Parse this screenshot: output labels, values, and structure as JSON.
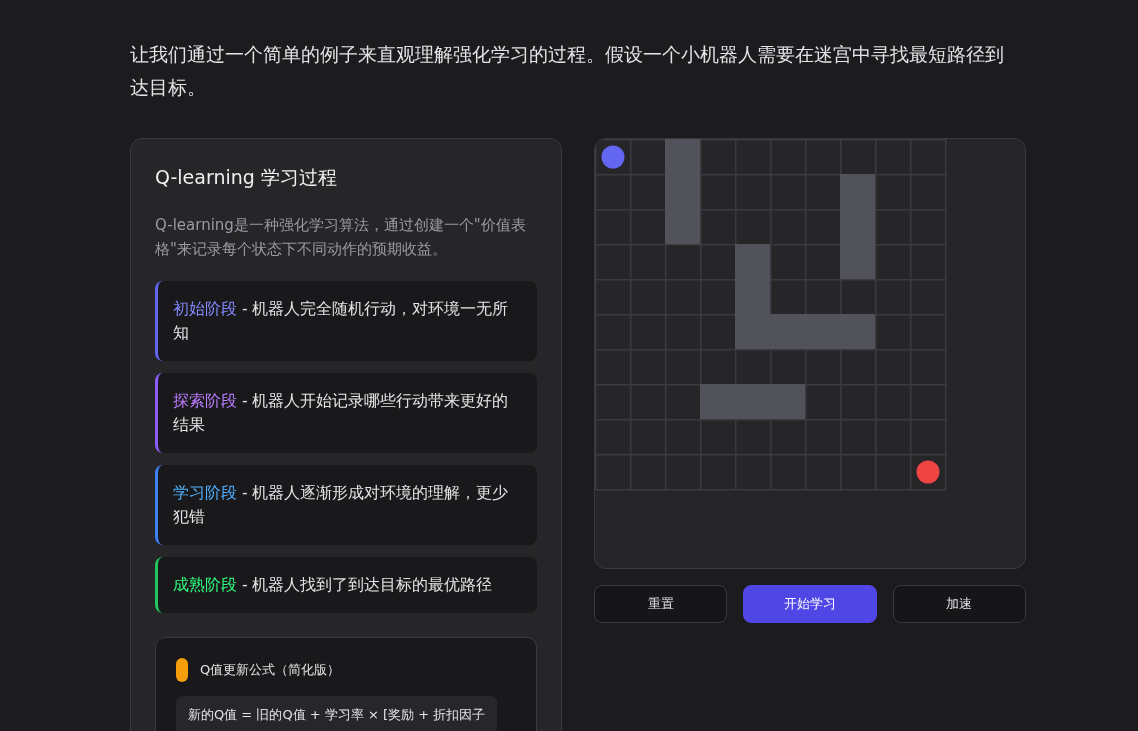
{
  "intro": "让我们通过一个简单的例子来直观理解强化学习的过程。假设一个小机器人需要在迷宫中寻找最短路径到达目标。",
  "card": {
    "title": "Q-learning 学习过程",
    "description": "Q-learning是一种强化学习算法，通过创建一个\"价值表格\"来记录每个状态下不同动作的预期收益。",
    "phases": [
      {
        "label": "初始阶段",
        "text": " - 机器人完全随机行动，对环境一无所知",
        "color": "#6366f1"
      },
      {
        "label": "探索阶段",
        "text": " - 机器人开始记录哪些行动带来更好的结果",
        "color": "#8b5cf6"
      },
      {
        "label": "学习阶段",
        "text": " - 机器人逐渐形成对环境的理解，更少犯错",
        "color": "#3b82f6"
      },
      {
        "label": "成熟阶段",
        "text": " - 机器人找到了到达目标的最优路径",
        "color": "#22c55e"
      }
    ],
    "formula": {
      "title": "Q值更新公式（简化版）",
      "text": "新的Q值 = 旧的Q值 + 学习率 × [奖励 + 折扣因子"
    }
  },
  "maze": {
    "rows": [
      {
        "cells": [
          {
            "kind": "robot"
          },
          {
            "kind": "empty"
          },
          {
            "kind": "wall"
          },
          {
            "kind": "empty"
          },
          {
            "kind": "empty"
          },
          {
            "kind": "empty"
          },
          {
            "kind": "empty"
          },
          {
            "kind": "empty"
          },
          {
            "kind": "empty"
          },
          {
            "kind": "empty"
          }
        ]
      },
      {
        "cells": [
          {
            "kind": "empty"
          },
          {
            "kind": "empty"
          },
          {
            "kind": "wall"
          },
          {
            "kind": "empty"
          },
          {
            "kind": "empty"
          },
          {
            "kind": "empty"
          },
          {
            "kind": "empty"
          },
          {
            "kind": "wall"
          },
          {
            "kind": "empty"
          },
          {
            "kind": "empty"
          }
        ]
      },
      {
        "cells": [
          {
            "kind": "empty"
          },
          {
            "kind": "empty"
          },
          {
            "kind": "wall"
          },
          {
            "kind": "empty"
          },
          {
            "kind": "empty"
          },
          {
            "kind": "empty"
          },
          {
            "kind": "empty"
          },
          {
            "kind": "wall"
          },
          {
            "kind": "empty"
          },
          {
            "kind": "empty"
          }
        ]
      },
      {
        "cells": [
          {
            "kind": "empty"
          },
          {
            "kind": "empty"
          },
          {
            "kind": "empty"
          },
          {
            "kind": "empty"
          },
          {
            "kind": "wall"
          },
          {
            "kind": "empty"
          },
          {
            "kind": "empty"
          },
          {
            "kind": "wall"
          },
          {
            "kind": "empty"
          },
          {
            "kind": "empty"
          }
        ]
      },
      {
        "cells": [
          {
            "kind": "empty"
          },
          {
            "kind": "empty"
          },
          {
            "kind": "empty"
          },
          {
            "kind": "empty"
          },
          {
            "kind": "wall"
          },
          {
            "kind": "empty"
          },
          {
            "kind": "empty"
          },
          {
            "kind": "empty"
          },
          {
            "kind": "empty"
          },
          {
            "kind": "empty"
          }
        ]
      },
      {
        "cells": [
          {
            "kind": "empty"
          },
          {
            "kind": "empty"
          },
          {
            "kind": "empty"
          },
          {
            "kind": "empty"
          },
          {
            "kind": "wall"
          },
          {
            "kind": "wall"
          },
          {
            "kind": "wall"
          },
          {
            "kind": "wall"
          },
          {
            "kind": "empty"
          },
          {
            "kind": "empty"
          }
        ]
      },
      {
        "cells": [
          {
            "kind": "empty"
          },
          {
            "kind": "empty"
          },
          {
            "kind": "empty"
          },
          {
            "kind": "empty"
          },
          {
            "kind": "empty"
          },
          {
            "kind": "empty"
          },
          {
            "kind": "empty"
          },
          {
            "kind": "empty"
          },
          {
            "kind": "empty"
          },
          {
            "kind": "empty"
          }
        ]
      },
      {
        "cells": [
          {
            "kind": "empty"
          },
          {
            "kind": "empty"
          },
          {
            "kind": "empty"
          },
          {
            "kind": "wall"
          },
          {
            "kind": "wall"
          },
          {
            "kind": "wall"
          },
          {
            "kind": "empty"
          },
          {
            "kind": "empty"
          },
          {
            "kind": "empty"
          },
          {
            "kind": "empty"
          }
        ]
      },
      {
        "cells": [
          {
            "kind": "empty"
          },
          {
            "kind": "empty"
          },
          {
            "kind": "empty"
          },
          {
            "kind": "empty"
          },
          {
            "kind": "empty"
          },
          {
            "kind": "empty"
          },
          {
            "kind": "empty"
          },
          {
            "kind": "empty"
          },
          {
            "kind": "empty"
          },
          {
            "kind": "empty"
          }
        ]
      },
      {
        "cells": [
          {
            "kind": "empty"
          },
          {
            "kind": "empty"
          },
          {
            "kind": "empty"
          },
          {
            "kind": "empty"
          },
          {
            "kind": "empty"
          },
          {
            "kind": "empty"
          },
          {
            "kind": "empty"
          },
          {
            "kind": "empty"
          },
          {
            "kind": "empty"
          },
          {
            "kind": "goal"
          }
        ]
      }
    ]
  },
  "buttons": [
    {
      "label": "重置",
      "primary": false
    },
    {
      "label": "开始学习",
      "primary": true
    },
    {
      "label": "加速",
      "primary": false
    }
  ]
}
